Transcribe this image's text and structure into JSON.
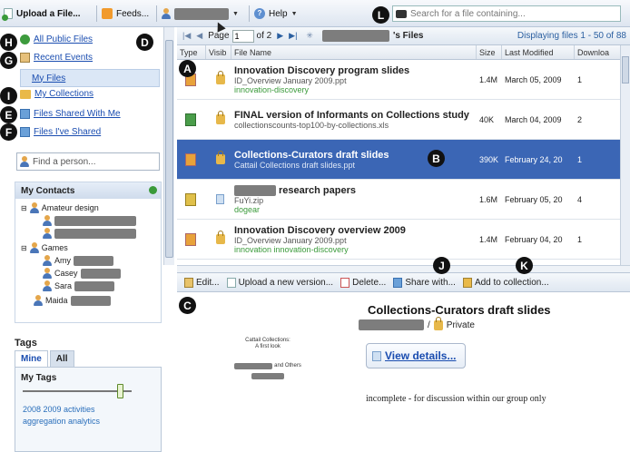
{
  "toolbar": {
    "upload_label": "Upload a File...",
    "feeds_label": "Feeds...",
    "help_label": "Help",
    "search_placeholder": "Search for a file containing..."
  },
  "markers": [
    "A",
    "B",
    "C",
    "D",
    "E",
    "F",
    "G",
    "H",
    "I",
    "J",
    "K",
    "L"
  ],
  "sidebar": {
    "items": [
      {
        "label": "All Public Files",
        "icon": "globe-icon"
      },
      {
        "label": "Recent Events",
        "icon": "calendar-icon"
      },
      {
        "label": "My Files",
        "icon": "page-icon"
      },
      {
        "label": "My Collections",
        "icon": "folder-icon"
      },
      {
        "label": "Files Shared With Me",
        "icon": "share-icon"
      },
      {
        "label": "Files I've Shared",
        "icon": "share-icon"
      }
    ],
    "find_placeholder": "Find a person..."
  },
  "contacts": {
    "title": "My Contacts",
    "groups": [
      {
        "name": "Amateur design"
      },
      {
        "name": "Games",
        "members": [
          "Amy",
          "Casey",
          "Sara"
        ]
      }
    ],
    "single": "Maida"
  },
  "tags": {
    "label": "Tags",
    "tabs": [
      "Mine",
      "All"
    ],
    "my_tags": "My Tags",
    "list_line1": "2008 2009 activities",
    "list_line2": "aggregation analytics"
  },
  "pager": {
    "page_label": "Page",
    "page_value": "1",
    "of_label": "of 2",
    "files_label": "'s Files",
    "displaying": "Displaying files 1 - 50 of 88"
  },
  "grid": {
    "headers": [
      "Type",
      "Visib",
      "File Name",
      "Size",
      "Last Modified",
      "Downloa"
    ],
    "rows": [
      {
        "title": "Innovation Discovery program slides",
        "sub": "ID_Overview January 2009.ppt",
        "tag": "innovation-discovery",
        "size": "1.4M",
        "date": "March 05, 2009",
        "downloads": "1",
        "type": "ppt",
        "visibility": "private"
      },
      {
        "title": "FINAL version of Informants on Collections study",
        "sub": "collectionscounts-top100-by-collections.xls",
        "tag": "",
        "size": "40K",
        "date": "March 04, 2009",
        "downloads": "2",
        "type": "xls",
        "visibility": "private"
      },
      {
        "title": "Collections-Curators draft slides",
        "sub": "Cattail Collections draft slides.ppt",
        "tag": "",
        "size": "390K",
        "date": "February 24, 20",
        "downloads": "1",
        "type": "ppt",
        "visibility": "private"
      },
      {
        "title": "research papers",
        "sub": "FuYi.zip",
        "tag": "dogear",
        "size": "1.6M",
        "date": "February 05, 20",
        "downloads": "4",
        "type": "zip",
        "visibility": "public"
      },
      {
        "title": "Innovation Discovery overview 2009",
        "sub": "ID_Overview January 2009.ppt",
        "tag": "innovation innovation-discovery",
        "size": "1.4M",
        "date": "February 04, 20",
        "downloads": "1",
        "type": "ppt",
        "visibility": "private"
      }
    ]
  },
  "actions": [
    "Edit...",
    "Upload a new version...",
    "Delete...",
    "Share with...",
    "Add to collection..."
  ],
  "preview": {
    "title": "Collections-Curators draft slides",
    "visibility": "Private",
    "view_details": "View details...",
    "description": "incomplete - for discussion within our group only",
    "thumb_line1": "Cattail Collections:",
    "thumb_line2": "A first look",
    "thumb_others": "and Others"
  }
}
